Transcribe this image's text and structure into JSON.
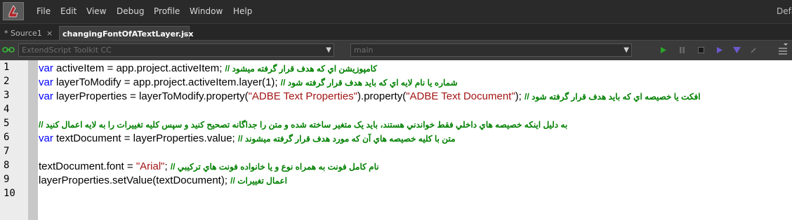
{
  "menubar": {
    "items": [
      "File",
      "Edit",
      "View",
      "Debug",
      "Profile",
      "Window",
      "Help"
    ],
    "right_label": "Defa"
  },
  "tabs": [
    {
      "label": "* Source1",
      "close": "×"
    },
    {
      "label": "changingFontOfATextLayer.jsx",
      "close": "×"
    }
  ],
  "toolbar": {
    "target_app": "ExtendScript Toolkit CC",
    "engine": "main"
  },
  "editor": {
    "line_numbers": [
      "1",
      "2",
      "3",
      "4",
      "5",
      "6",
      "7",
      "8",
      "9",
      "10"
    ],
    "lines": [
      [
        {
          "t": "kw",
          "v": "var"
        },
        {
          "t": "p",
          "v": " activeItem = app.project.activeItem; "
        },
        {
          "t": "cm",
          "v": "// کامپوزیشن اي که هدف قرار گرفته میشود"
        }
      ],
      [
        {
          "t": "kw",
          "v": "var"
        },
        {
          "t": "p",
          "v": " layerToModify = app.project.activeItem.layer("
        },
        {
          "t": "num",
          "v": "1"
        },
        {
          "t": "p",
          "v": "); "
        },
        {
          "t": "cm",
          "v": "// شماره یا نام لایه اي که باید هدف قرار گرفته شود"
        }
      ],
      [
        {
          "t": "kw",
          "v": "var"
        },
        {
          "t": "p",
          "v": " layerProperties = layerToModify.property("
        },
        {
          "t": "str",
          "v": "\"ADBE Text Properties\""
        },
        {
          "t": "p",
          "v": ").property("
        },
        {
          "t": "str",
          "v": "\"ADBE Text Document\""
        },
        {
          "t": "p",
          "v": "); "
        },
        {
          "t": "cm",
          "v": "// افکت یا خصیصه اي که باید هدف قرار گرفته شود"
        }
      ],
      [],
      [
        {
          "t": "cm",
          "v": "// به دلیل اینکه خصیصه هاي داخلي فقط خواندني هستند، باید یک متغیر ساخته شده و متن را جداگانه تصحیح کنید و سپس کلیه تغییرات را به لایه اعمال کنید"
        }
      ],
      [
        {
          "t": "kw",
          "v": "var"
        },
        {
          "t": "p",
          "v": " textDocument = layerProperties.value; "
        },
        {
          "t": "cm",
          "v": "// متن با کلیه خصیصه هاي آن که مورد هدف قرار گرفته میشوند"
        }
      ],
      [],
      [
        {
          "t": "p",
          "v": "textDocument.font = "
        },
        {
          "t": "str",
          "v": "\"Arial\""
        },
        {
          "t": "p",
          "v": "; "
        },
        {
          "t": "cm",
          "v": "// نام کامل فونت به همراه نوع و یا خانواده فونت هاي ترکیبي"
        }
      ],
      [
        {
          "t": "p",
          "v": "layerProperties.setValue(textDocument); "
        },
        {
          "t": "cm",
          "v": "// اعمال تغییرات"
        }
      ],
      []
    ]
  },
  "colors": {
    "keyword": "#0000ff",
    "string": "#a31515",
    "comment": "#008000",
    "play_button": "#2aa52a",
    "step_buttons": "#6a5acd"
  },
  "icons": [
    "app-logo-icon",
    "link-icon",
    "play-icon",
    "pause-icon",
    "stop-icon",
    "step-into-icon",
    "step-over-icon",
    "step-out-icon",
    "panel-menu-icon"
  ]
}
